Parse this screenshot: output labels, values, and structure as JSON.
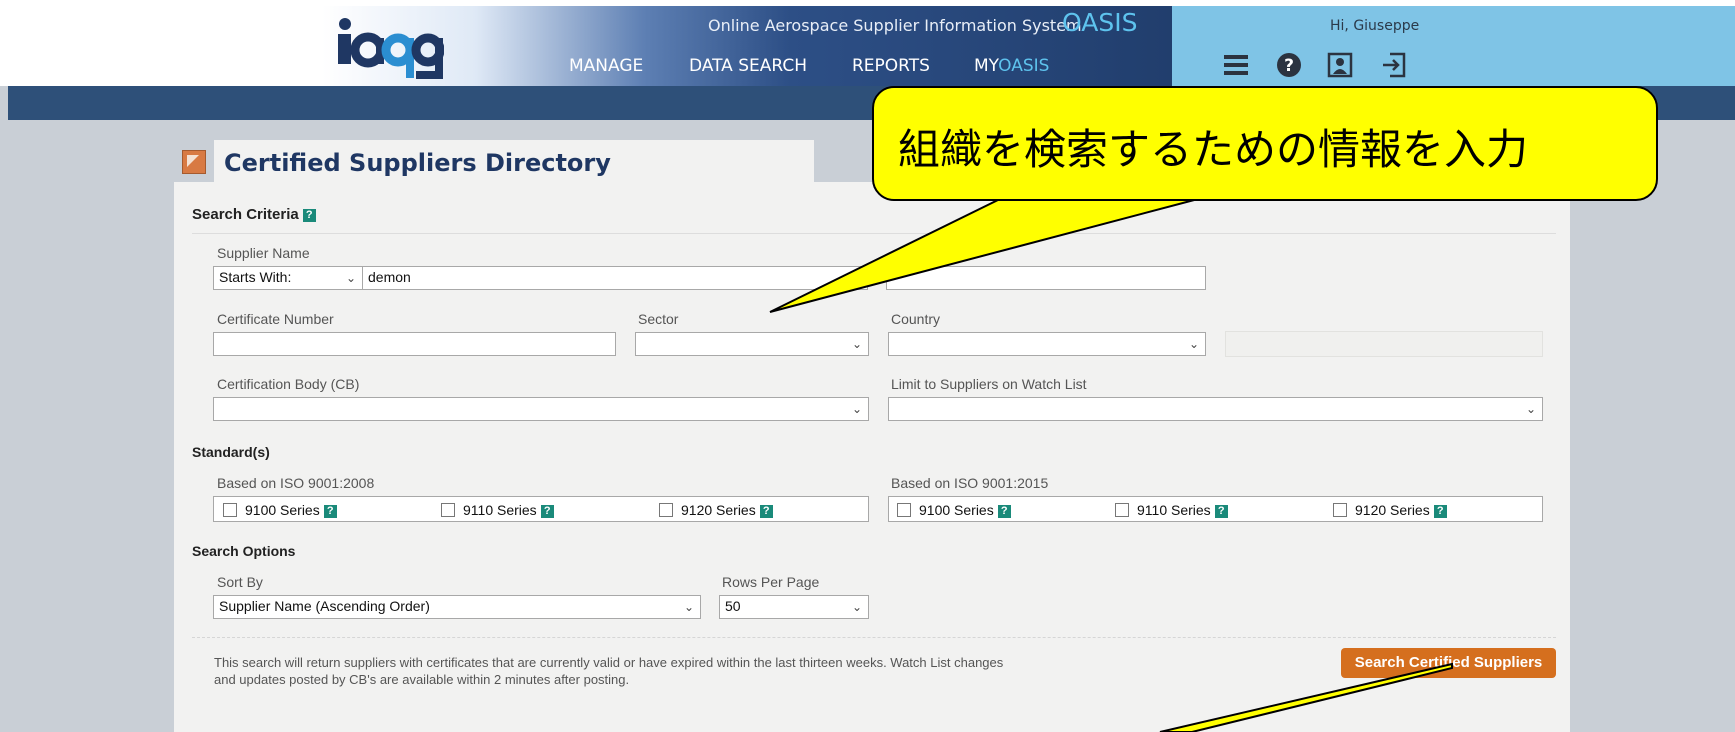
{
  "header": {
    "system_title": "Online Aerospace Supplier Information System",
    "brand": "OASIS",
    "nav": [
      {
        "label": "MANAGE"
      },
      {
        "label": "DATA SEARCH"
      },
      {
        "label": "REPORTS"
      },
      {
        "prefix": "MY",
        "suffix": "OASIS"
      }
    ],
    "greeting": "Hi, Giuseppe",
    "icons": [
      "menu-icon",
      "help-icon",
      "profile-icon",
      "logout-icon"
    ]
  },
  "page": {
    "title": "Certified Suppliers Directory"
  },
  "criteria": {
    "heading": "Search Criteria",
    "help_glyph": "?",
    "supplier_name": {
      "label": "Supplier Name",
      "mode": "Starts With:",
      "value": "demon"
    },
    "certificate_number": {
      "label": "Certificate Number",
      "value": ""
    },
    "sector": {
      "label": "Sector",
      "value": ""
    },
    "country": {
      "label": "Country",
      "value": ""
    },
    "cb": {
      "label": "Certification Body (CB)",
      "value": ""
    },
    "watch_list": {
      "label": "Limit to Suppliers on Watch List",
      "value": ""
    }
  },
  "standards": {
    "heading": "Standard(s)",
    "groups": [
      {
        "label": "Based on ISO 9001:2008",
        "items": [
          "9100 Series",
          "9110 Series",
          "9120 Series"
        ]
      },
      {
        "label": "Based on ISO 9001:2015",
        "items": [
          "9100 Series",
          "9110 Series",
          "9120 Series"
        ]
      }
    ]
  },
  "options": {
    "heading": "Search Options",
    "sort_by": {
      "label": "Sort By",
      "value": "Supplier Name (Ascending Order)"
    },
    "rows_per_page": {
      "label": "Rows Per Page",
      "value": "50"
    }
  },
  "footer": {
    "note_line1": "This search will return suppliers with certificates that are currently valid or have expired within the last thirteen weeks. Watch List changes",
    "note_line2": "and updates posted by CB's are available within 2 minutes after posting.",
    "search_button": "Search Certified Suppliers"
  },
  "annotation": {
    "text": "組織を検索するための情報を入力"
  },
  "colors": {
    "accent": "#d56f1e",
    "navy": "#1f3763",
    "callout": "#ffff00",
    "brand_blue": "#5ec3ee"
  }
}
